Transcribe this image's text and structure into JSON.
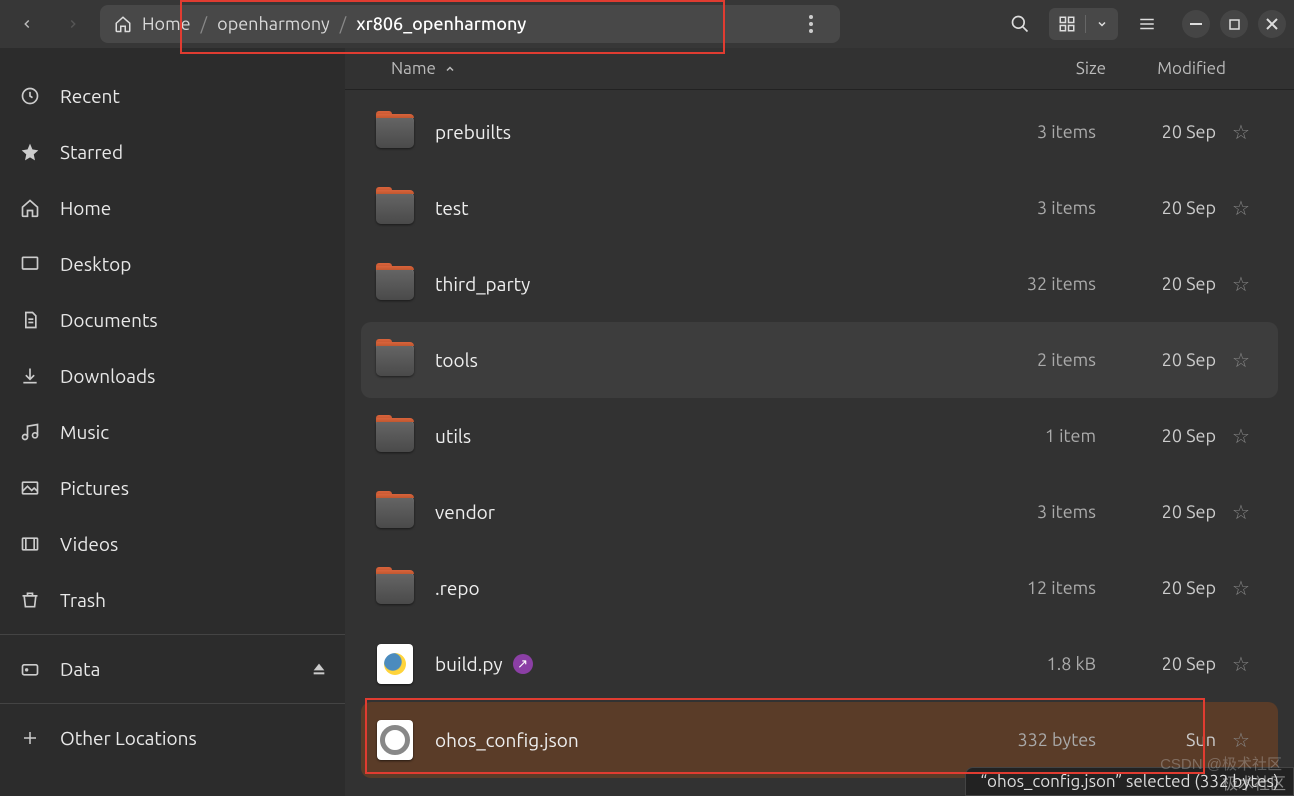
{
  "breadcrumb": {
    "home": "Home",
    "mid": "openharmony",
    "current": "xr806_openharmony"
  },
  "sidebar": [
    {
      "icon": "clock",
      "label": "Recent"
    },
    {
      "icon": "star",
      "label": "Starred"
    },
    {
      "icon": "home",
      "label": "Home"
    },
    {
      "icon": "desktop",
      "label": "Desktop"
    },
    {
      "icon": "doc",
      "label": "Documents"
    },
    {
      "icon": "download",
      "label": "Downloads"
    },
    {
      "icon": "music",
      "label": "Music"
    },
    {
      "icon": "picture",
      "label": "Pictures"
    },
    {
      "icon": "video",
      "label": "Videos"
    },
    {
      "icon": "trash",
      "label": "Trash"
    }
  ],
  "sidebar_data": {
    "icon": "disk",
    "label": "Data"
  },
  "sidebar_other": {
    "icon": "plus",
    "label": "Other Locations"
  },
  "columns": {
    "name": "Name",
    "size": "Size",
    "modified": "Modified"
  },
  "files": [
    {
      "type": "folder",
      "name": "prebuilts",
      "size": "3 items",
      "mod": "20 Sep"
    },
    {
      "type": "folder",
      "name": "test",
      "size": "3 items",
      "mod": "20 Sep"
    },
    {
      "type": "folder",
      "name": "third_party",
      "size": "32 items",
      "mod": "20 Sep"
    },
    {
      "type": "folder",
      "name": "tools",
      "size": "2 items",
      "mod": "20 Sep",
      "hover": true
    },
    {
      "type": "folder",
      "name": "utils",
      "size": "1 item",
      "mod": "20 Sep"
    },
    {
      "type": "folder",
      "name": "vendor",
      "size": "3 items",
      "mod": "20 Sep"
    },
    {
      "type": "folder",
      "name": ".repo",
      "size": "12 items",
      "mod": "20 Sep"
    },
    {
      "type": "py",
      "name": "build.py",
      "size": "1.8 kB",
      "mod": "20 Sep",
      "link": true
    },
    {
      "type": "json",
      "name": "ohos_config.json",
      "size": "332 bytes",
      "mod": "Sun",
      "selected": true
    }
  ],
  "statusbar": "“ohos_config.json” selected (332 bytes)",
  "watermark1": "CSDN @极术社区",
  "watermark2": "极术社区"
}
